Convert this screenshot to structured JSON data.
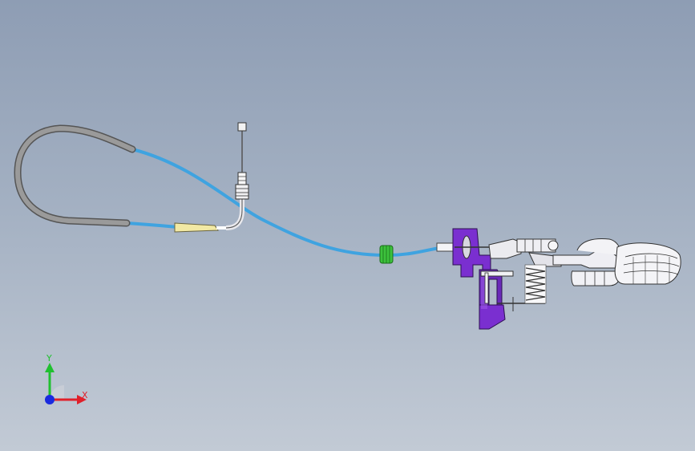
{
  "viewport": {
    "background_top": "#8e9db4",
    "background_bottom": "#c2cad5"
  },
  "model": {
    "cable_color": "#3fa3e0",
    "sheath_color": "#8c8c8c",
    "nut_color": "#3cc23c",
    "bracket_color": "#7a2fd0",
    "ferrule_color": "#f2e9a4"
  },
  "triad": {
    "x_label": "X",
    "y_label": "Y",
    "x_color": "#e0202a",
    "y_color": "#20c030",
    "z_color": "#1a2adf"
  }
}
